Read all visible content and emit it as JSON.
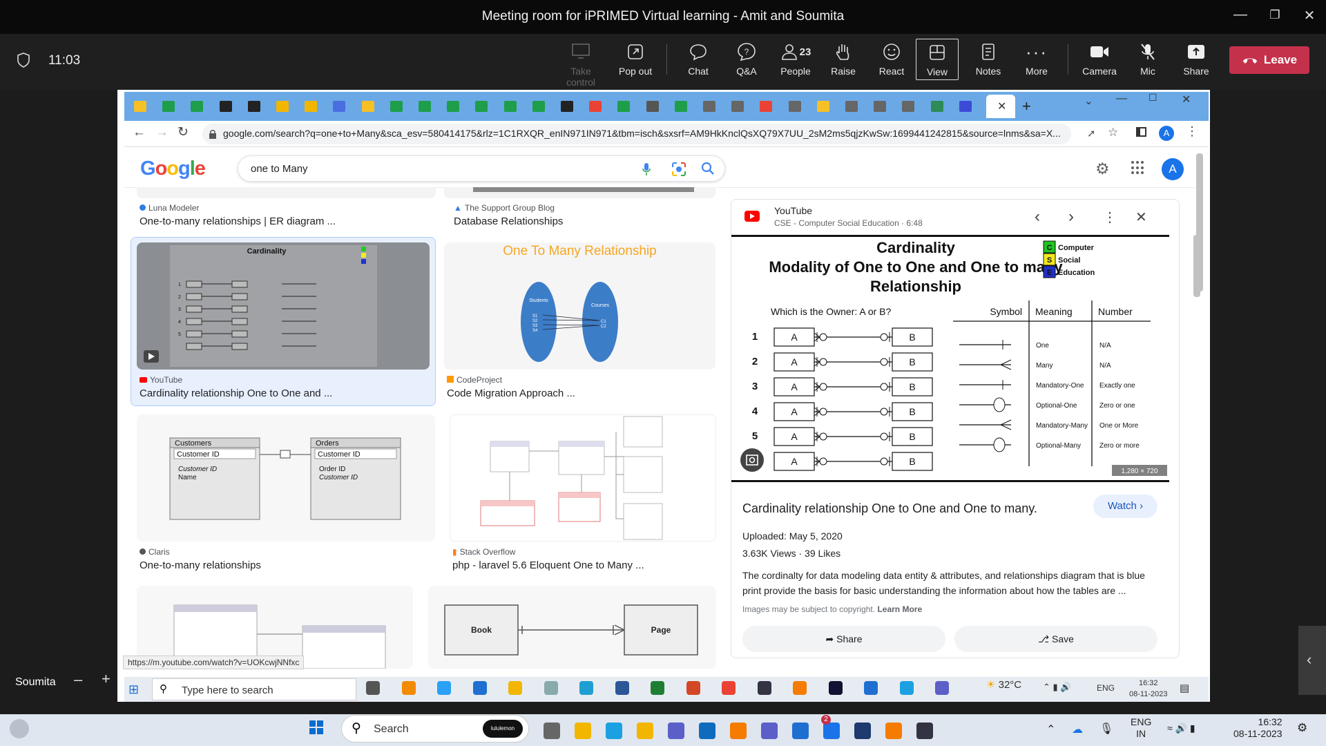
{
  "window": {
    "title": "Meeting room for iPRIMED Virtual learning - Amit and Soumita"
  },
  "meeting": {
    "time": "11:03",
    "controls": [
      {
        "label": "Take control",
        "icon": "take-control-icon"
      },
      {
        "label": "Pop out",
        "icon": "pop-out-icon"
      },
      {
        "label": "Chat",
        "icon": "chat-icon"
      },
      {
        "label": "Q&A",
        "icon": "qa-icon"
      },
      {
        "label": "People",
        "icon": "people-icon",
        "count": "23"
      },
      {
        "label": "Raise",
        "icon": "raise-hand-icon"
      },
      {
        "label": "React",
        "icon": "react-icon"
      },
      {
        "label": "View",
        "icon": "view-icon"
      },
      {
        "label": "Notes",
        "icon": "notes-icon"
      },
      {
        "label": "More",
        "icon": "more-icon"
      },
      {
        "label": "Camera",
        "icon": "camera-icon"
      },
      {
        "label": "Mic",
        "icon": "mic-muted-icon"
      },
      {
        "label": "Share",
        "icon": "share-icon"
      }
    ],
    "leave_label": "Leave",
    "participant": "Soumita"
  },
  "browser": {
    "url": "google.com/search?q=one+to+Many&sca_esv=580414175&rlz=1C1RXQR_enIN971IN971&tbm=isch&sxsrf=AM9HkKnclQsXQ79X7UU_2sM2ms5qjzKwSw:1699441242815&source=lnms&sa=X...",
    "status_url": "https://m.youtube.com/watch?v=UOKcwjNNfxc"
  },
  "google": {
    "logo": "Google",
    "query": "one to Many",
    "avatar": "A"
  },
  "results": [
    {
      "source": "Luna Modeler",
      "title": "One-to-many relationships | ER diagram ..."
    },
    {
      "source": "The Support Group Blog",
      "title": "Database Relationships"
    },
    {
      "source": "YouTube",
      "title": "Cardinality relationship One to One and ..."
    },
    {
      "source": "CodeProject",
      "title": "Code Migration Approach ..."
    },
    {
      "source": "Claris",
      "title": "One-to-many relationships"
    },
    {
      "source": "Stack Overflow",
      "title": "php - laravel 5.6 Eloquent One to Many ..."
    }
  ],
  "thumb_texts": {
    "otm_title": "One To Many Relationship",
    "students": "Students",
    "courses": "Courses",
    "students_rows": [
      "S1",
      "S2",
      "S3",
      "S4"
    ],
    "courses_rows": [
      "C1",
      "C2"
    ],
    "customers": "Customers",
    "orders": "Orders",
    "customer_id": "Customer ID",
    "name": "Name",
    "order_id": "Order ID",
    "book": "Book",
    "page": "Page"
  },
  "preview": {
    "channel": "YouTube",
    "subtitle": "CSE - Computer Social Education · 6:48",
    "image_title": "Cardinality",
    "image_subtitle": "Modality of One to One and One to many Relationship",
    "owner_q": "Which is the Owner: A or B?",
    "legend": [
      {
        "letter": "C",
        "text": "Computer",
        "color": "#22c322"
      },
      {
        "letter": "S",
        "text": "Social",
        "color": "#f2e71c"
      },
      {
        "letter": "E",
        "text": "Education",
        "color": "#2030c8"
      }
    ],
    "rows": [
      {
        "n": "1",
        "a": "A",
        "b": "B"
      },
      {
        "n": "2",
        "a": "A",
        "b": "B"
      },
      {
        "n": "3",
        "a": "A",
        "b": "B"
      },
      {
        "n": "4",
        "a": "A",
        "b": "B"
      },
      {
        "n": "5",
        "a": "A",
        "b": "B"
      },
      {
        "n": "",
        "a": "A",
        "b": "B"
      }
    ],
    "table_headers": [
      "Symbol",
      "Meaning",
      "Number"
    ],
    "meanings": [
      {
        "meaning": "One",
        "number": "N/A"
      },
      {
        "meaning": "Many",
        "number": "N/A"
      },
      {
        "meaning": "Mandatory-One",
        "number": "Exactly one"
      },
      {
        "meaning": "Optional-One",
        "number": "Zero or one"
      },
      {
        "meaning": "Mandatory-Many",
        "number": "One or More"
      },
      {
        "meaning": "Optional-Many",
        "number": "Zero or more"
      }
    ],
    "dimensions": "1,280 × 720",
    "title": "Cardinality relationship One to One and One to many.",
    "watch_label": "Watch",
    "uploaded": "Uploaded: May 5, 2020",
    "views": "3.63K Views",
    "likes": "39 Likes",
    "description": "The cordinalty for data modeling data entity & attributes, and relationships diagram that is blue print provide the basis for basic understanding the information about how the tables are ...",
    "copyright": "Images may be subject to copyright.",
    "learn_more": "Learn More",
    "share_label": "Share",
    "save_label": "Save"
  },
  "shared_taskbar": {
    "search_placeholder": "Type here to search",
    "temp": "32°C",
    "lang": "ENG",
    "time": "16:32",
    "date": "08-11-2023"
  },
  "taskbar": {
    "search_label": "Search",
    "badge": "lululemon",
    "lang1": "ENG",
    "lang2": "IN",
    "time": "16:32",
    "date": "08-11-2023",
    "teams_badge": "2"
  }
}
